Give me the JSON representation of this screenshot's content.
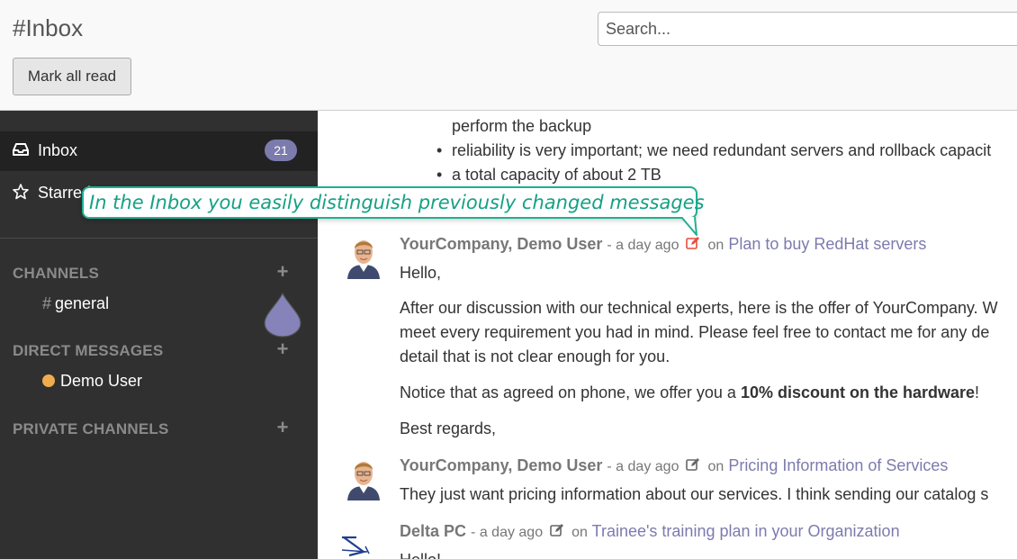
{
  "header": {
    "title": "#Inbox",
    "search_placeholder": "Search...",
    "mark_all_read": "Mark all read"
  },
  "sidebar": {
    "inbox": {
      "label": "Inbox",
      "badge": "21",
      "icon": "inbox-icon"
    },
    "starred": {
      "label": "Starred",
      "icon": "star-icon"
    },
    "channels_title": "CHANNELS",
    "channels": [
      {
        "hash": "#",
        "name": "general"
      }
    ],
    "direct_title": "DIRECT MESSAGES",
    "direct": [
      {
        "name": "Demo User",
        "status_color": "#f0ad4e"
      }
    ],
    "private_title": "PRIVATE CHANNELS",
    "plus": "+"
  },
  "tooltip": {
    "text": "In the Inbox you easily distinguish previously changed messages"
  },
  "messages": {
    "bullets": [
      "perform the backup",
      "reliability is very important; we need redundant servers and rollback capacit",
      "a total capacity of about 2 TB"
    ],
    "msg1": {
      "author": "YourCompany, Demo User",
      "time": "- a day ago",
      "on": "on",
      "record": "Plan to buy RedHat servers",
      "greeting": "Hello,",
      "para1": [
        "After our discussion with our technical experts, here is the offer of YourCompany. W",
        "meet every requirement you had in mind. Please feel free to contact me for any de",
        "detail that is not clear enough for you."
      ],
      "notice_pre": "Notice that as agreed on phone, we offer you a ",
      "notice_bold": "10% discount on the hardware",
      "notice_post": "!",
      "regards": "Best regards,"
    },
    "msg2": {
      "author": "YourCompany, Demo User",
      "time": "- a day ago",
      "on": "on",
      "record": "Pricing Information of Services",
      "body": "They just want pricing information about our services. I think sending our catalog s"
    },
    "msg3": {
      "author": "Delta PC",
      "time": "- a day ago",
      "on": "on",
      "record": "Trainee's training plan in your Organization",
      "body": "Hello!"
    }
  },
  "colors": {
    "accent": "#7c7bad",
    "tooltip": "#16a085",
    "sidebar_bg": "#303030",
    "edited_icon": "#e74c3c"
  }
}
